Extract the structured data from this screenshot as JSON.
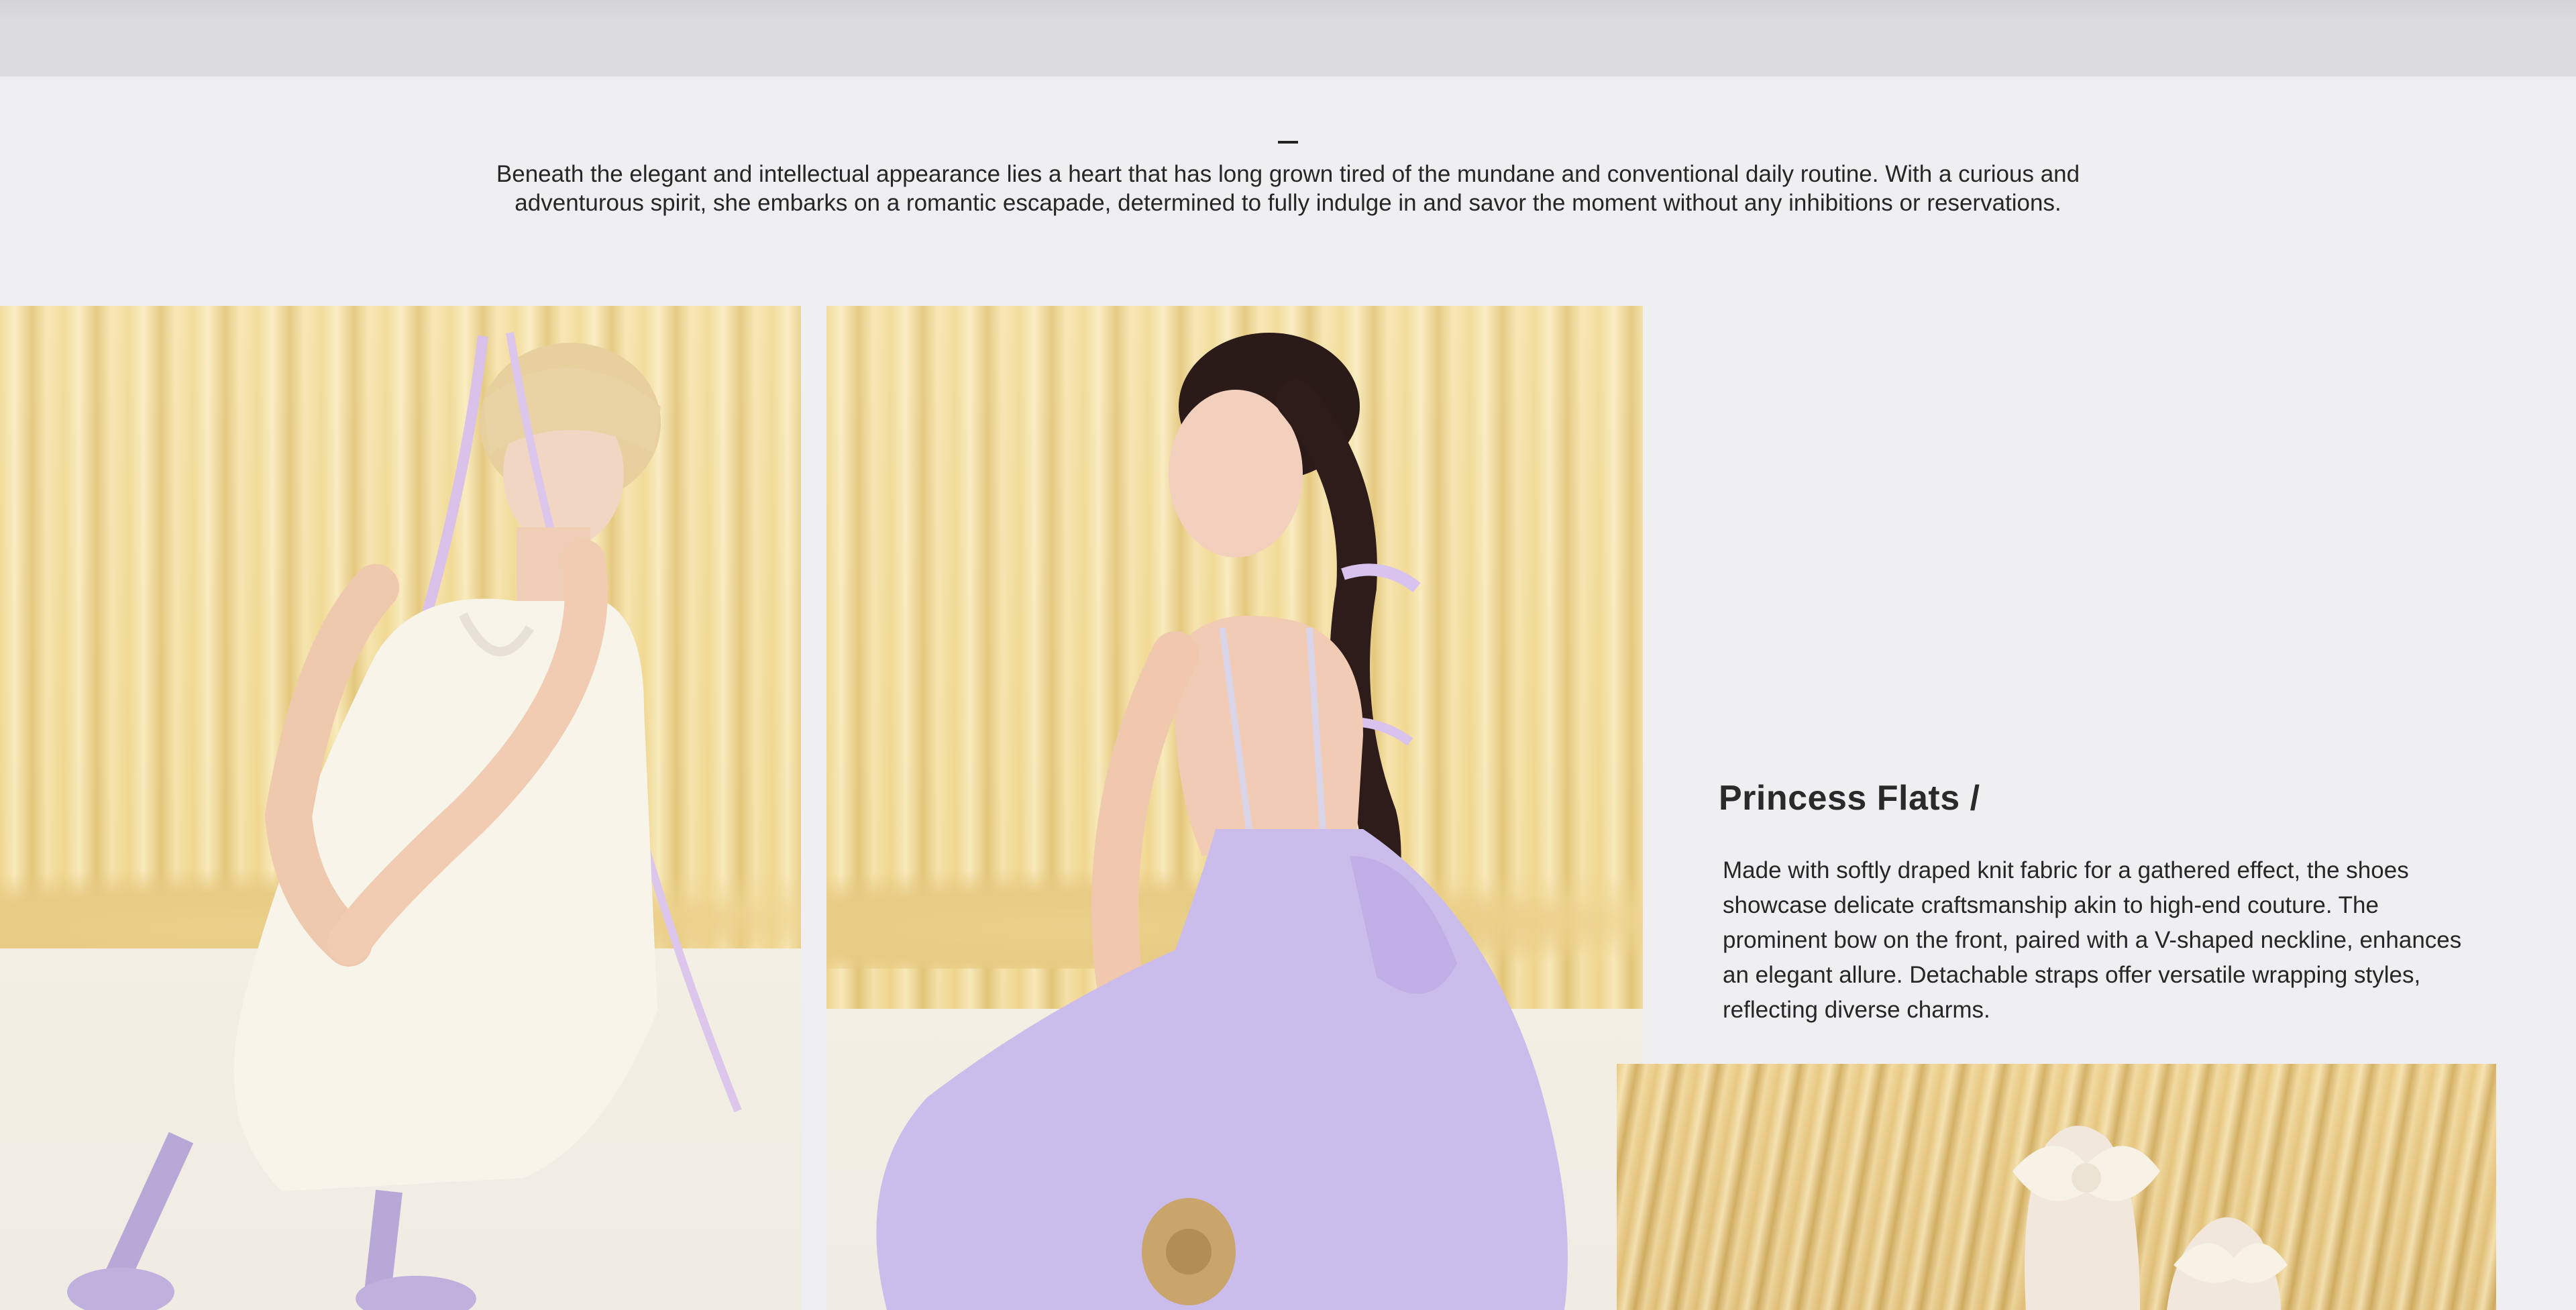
{
  "intro": {
    "dash": "–",
    "text": "Beneath the elegant and intellectual appearance lies a heart that has long grown tired of the mundane and conventional daily routine. With a curious and adventurous spirit, she embarks on a romantic escapade, determined to fully indulge in and savor the moment without any inhibitions or reservations."
  },
  "product": {
    "title": "Princess Flats /",
    "description": "Made with softly draped knit fabric for a gathered effect, the shoes showcase delicate craftsmanship akin to high-end couture. The prominent bow on the front, paired with a V-shaped neckline, enhances an elegant allure. Detachable straps offer versatile wrapping styles, reflecting diverse charms."
  },
  "photos": [
    {
      "name": "model-white-dress-photo"
    },
    {
      "name": "model-lilac-dress-photo"
    },
    {
      "name": "shoes-closeup-photo"
    }
  ],
  "colors": {
    "page_background": "#efeef0",
    "top_bar": "#dcdcde",
    "text": "#262626",
    "curtain": "#f0d68e",
    "lilac": "#c9b8ea"
  }
}
